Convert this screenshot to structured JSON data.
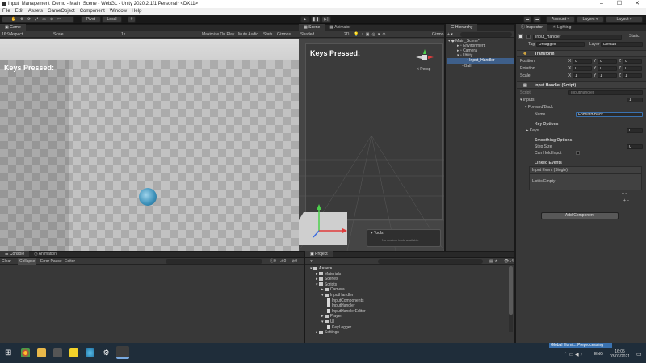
{
  "window": {
    "title": "Input_Management_Demo - Main_Scene - WebGL - Unity 2020.2.1f1 Personal* <DX11>",
    "controls": [
      "–",
      "☐",
      "✕"
    ]
  },
  "menu": [
    "File",
    "Edit",
    "Assets",
    "GameObject",
    "Component",
    "Window",
    "Help"
  ],
  "toolbar": {
    "pivot": "Pivot",
    "local": "Local",
    "account": "Account",
    "layers": "Layers",
    "layout": "Layout"
  },
  "game": {
    "tab": "Game",
    "aspect": "16:9 Aspect",
    "scale_label": "Scale",
    "scale_value": "1x",
    "maximize": "Maximize On Play",
    "mute": "Mute Audio",
    "stats": "Stats",
    "gizmos": "Gizmos",
    "keys_text": "Keys Pressed:"
  },
  "scene": {
    "tabs": [
      "Scene",
      "Animator"
    ],
    "shading": "Shaded",
    "mode": "2D",
    "gizmos": "Gizmo",
    "keys_text": "Keys Pressed:",
    "persp": "< Persp",
    "tools_title": "Tools",
    "tools_body": "No custom tools available"
  },
  "hierarchy": {
    "tab": "Hierarchy",
    "scene": "Main_Scene*",
    "items": [
      "Environment",
      "Camera",
      "Utility",
      "Input_Handler",
      "Ball"
    ]
  },
  "inspector": {
    "tabs": [
      "Inspector",
      "Lighting"
    ],
    "object_name": "Input_Handler",
    "static_label": "Static",
    "tag_label": "Tag",
    "tag_value": "Untagged",
    "layer_label": "Layer",
    "layer_value": "Default",
    "transform": {
      "title": "Transform",
      "rows": [
        {
          "label": "Position",
          "x": "0",
          "y": "0",
          "z": "0"
        },
        {
          "label": "Rotation",
          "x": "0",
          "y": "0",
          "z": "0"
        },
        {
          "label": "Scale",
          "x": "1",
          "y": "1",
          "z": "1"
        }
      ]
    },
    "script": {
      "title": "Input Handler (Script)",
      "script_label": "Script",
      "script_value": "InputHandler",
      "inputs_label": "Inputs",
      "inputs_count": "1",
      "element_label": "Forward/Back",
      "name_label": "Name",
      "name_value": "Forward/Back",
      "key_options": "Key Options",
      "keys_label": "Keys",
      "keys_count": "0",
      "smoothing": "Smoothing Options",
      "step_label": "Step Size",
      "step_value": "0",
      "hold_label": "Can Hold Input",
      "linked_events": "Linked Events",
      "event_label": "Input Event (Single)",
      "list_empty": "List is Empty",
      "add_component": "Add Component"
    }
  },
  "console": {
    "tabs": [
      "Console",
      "Animation"
    ],
    "buttons": [
      "Clear",
      "Collapse",
      "Error Pause",
      "Editor"
    ],
    "counts": [
      "0",
      "0",
      "0"
    ]
  },
  "project": {
    "tab": "Project",
    "count": "14",
    "tree": [
      {
        "label": "Assets",
        "depth": 0,
        "type": "folder"
      },
      {
        "label": "Materials",
        "depth": 1,
        "type": "folder"
      },
      {
        "label": "Scenes",
        "depth": 1,
        "type": "folder"
      },
      {
        "label": "Scripts",
        "depth": 1,
        "type": "folder"
      },
      {
        "label": "Camera",
        "depth": 2,
        "type": "folder"
      },
      {
        "label": "InputHandler",
        "depth": 2,
        "type": "folder"
      },
      {
        "label": "InputComponents",
        "depth": 3,
        "type": "file"
      },
      {
        "label": "InputHandler",
        "depth": 3,
        "type": "file"
      },
      {
        "label": "InputHandlerEditor",
        "depth": 3,
        "type": "file"
      },
      {
        "label": "Player",
        "depth": 2,
        "type": "folder"
      },
      {
        "label": "UI",
        "depth": 2,
        "type": "folder"
      },
      {
        "label": "KeyLogger",
        "depth": 3,
        "type": "file"
      },
      {
        "label": "Settings",
        "depth": 1,
        "type": "folder"
      }
    ]
  },
  "status": {
    "progress": "Global Illumi... Preprocessing"
  },
  "taskbar": {
    "lang": "ENG",
    "time": "16:05",
    "date": "03/03/2021"
  },
  "colors": {
    "panel": "#383838",
    "dark": "#191919",
    "accent": "#3a72b0",
    "taskbar": "#1f2d3a"
  }
}
